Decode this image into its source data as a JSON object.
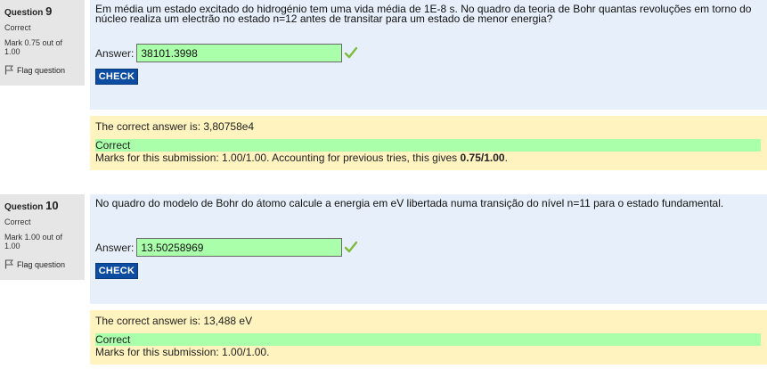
{
  "questions": [
    {
      "label": "Question",
      "number": "9",
      "state": "Correct",
      "grade_line1": "Mark 0.75 out of",
      "grade_line2": "1.00",
      "flag_label": "Flag question",
      "text": "Em média um estado excitado do hidrogénio tem uma vida média de 1E-8 s. No quadro da teoria de Bohr quantas revoluções em torno do núcleo realiza um electrão no estado n=12 antes de transitar para um estado de menor energia?",
      "answer_label": "Answer:",
      "answer_value": "38101.3998",
      "check_label": "CHECK",
      "right_answer": "The correct answer is: 3,80758e4",
      "feedback": "Correct",
      "marks_text": "Marks for this submission: 1.00/1.00. Accounting for previous tries, this gives ",
      "marks_bold": "0.75/1.00",
      "marks_end": "."
    },
    {
      "label": "Question",
      "number": "10",
      "state": "Correct",
      "grade_line1": "Mark 1.00 out of",
      "grade_line2": "1.00",
      "flag_label": "Flag question",
      "text": "No quadro do modelo de Bohr do átomo calcule a energia em eV libertada numa transição do nível n=11 para o estado fundamental.",
      "answer_label": "Answer:",
      "answer_value": "13.50258969",
      "check_label": "CHECK",
      "right_answer": "The correct answer is: 13,488 eV",
      "feedback": "Correct",
      "marks_text": "Marks for this submission: 1.00/1.00."
    }
  ],
  "colors": {
    "info_bg": "#e6e6e6",
    "formulation_bg": "#e7f0fa",
    "outcome_bg": "#fff3bf",
    "correct_green": "#aaffaa",
    "check_button": "#0c4da2",
    "tick": "#7dbb3a"
  },
  "icons": {
    "flag": "flag-icon",
    "tick": "correct-tick-icon"
  }
}
